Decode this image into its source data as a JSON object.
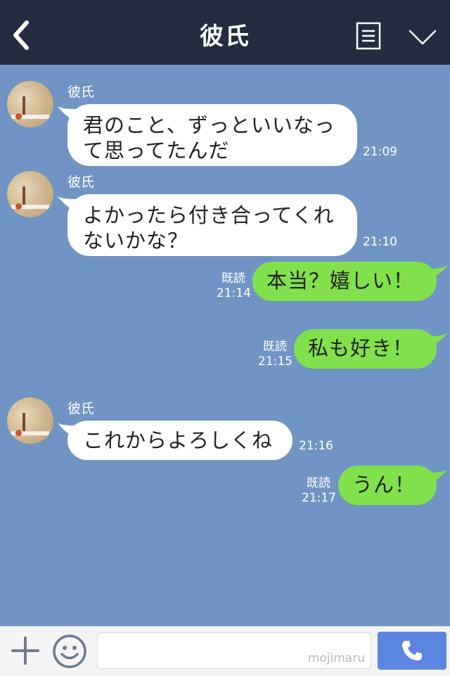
{
  "header": {
    "title": "彼氏",
    "back_icon": "chevron-left-icon",
    "menu_icon": "document-list-icon",
    "collapse_icon": "chevron-down-icon"
  },
  "messages": [
    {
      "direction": "in",
      "sender": "彼氏",
      "lines": [
        "君のこと、ずっといいなっ",
        "て思ってたんだ"
      ],
      "time": "21:09"
    },
    {
      "direction": "in",
      "sender": "彼氏",
      "lines": [
        "よかったら付き合ってくれ",
        "ないかな？"
      ],
      "time": "21:10"
    },
    {
      "direction": "out",
      "text": "本当？嬉しい！",
      "read": "既読",
      "time": "21:14"
    },
    {
      "direction": "out",
      "text": "私も好き！",
      "read": "既読",
      "time": "21:15"
    },
    {
      "direction": "in",
      "sender": "彼氏",
      "lines": [
        "これからよろしくね"
      ],
      "time": "21:16"
    },
    {
      "direction": "out",
      "text": "うん！",
      "read": "既読",
      "time": "21:17"
    }
  ],
  "footer": {
    "plus_icon": "plus-icon",
    "emoji_icon": "smile-icon",
    "input_value": "",
    "watermark": "mojimaru",
    "call_icon": "phone-icon"
  },
  "colors": {
    "header_bg": "#232c41",
    "chat_bg": "#7095c4",
    "incoming_bubble": "#ffffff",
    "outgoing_bubble": "#81e04b",
    "call_button": "#5b86e2"
  }
}
